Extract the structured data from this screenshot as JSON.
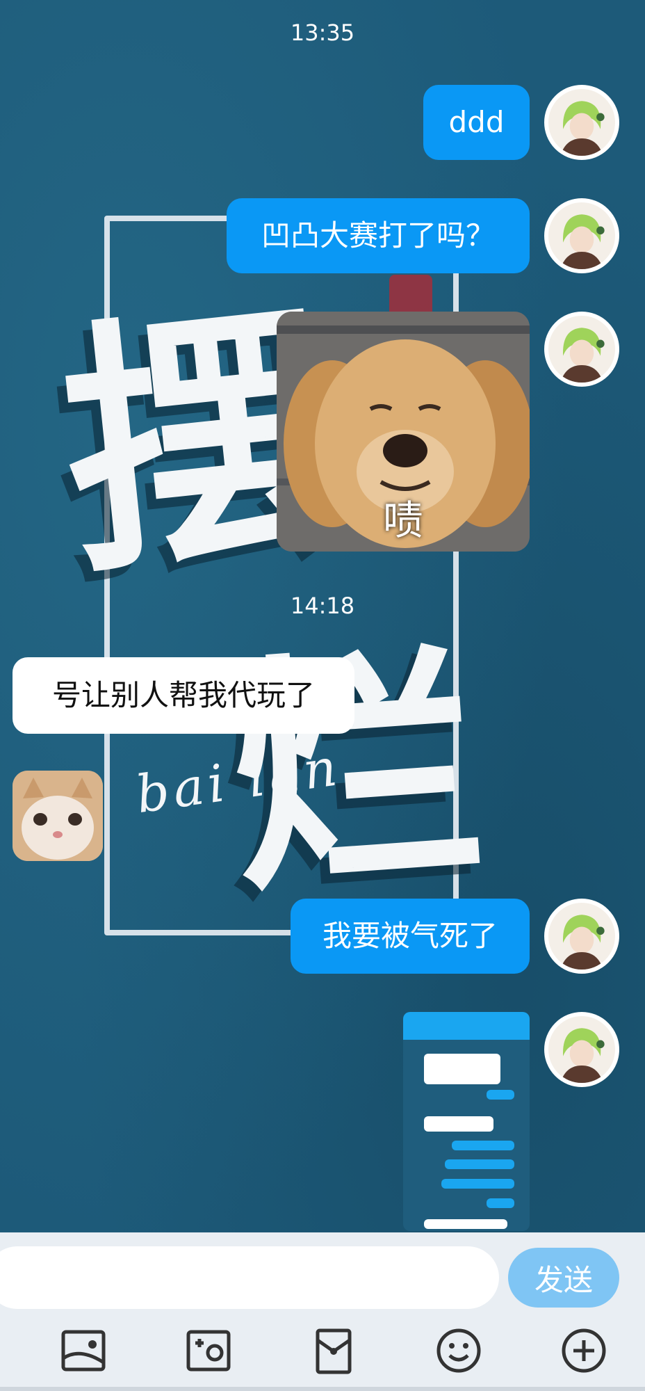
{
  "chat": {
    "timestamps": [
      "13:35",
      "14:18"
    ],
    "messages": {
      "m1": "ddd",
      "m2": "凹凸大赛打了吗？",
      "dog_caption": "啧",
      "m3": "号让别人帮我代玩了",
      "m4": "我要被气死了"
    }
  },
  "wallpaper": {
    "brush_1": "摆",
    "brush_2": "烂",
    "script": "bai lan"
  },
  "input_bar": {
    "placeholder": "",
    "send_label": "发送"
  },
  "toolbar": {
    "icons": [
      "image-icon",
      "camera-icon",
      "red-packet-icon",
      "emoji-icon",
      "plus-icon"
    ]
  },
  "colors": {
    "my_bubble": "#0a98f5",
    "other_bubble": "#ffffff",
    "send_button": "#7fc5f4",
    "background": "#1d5a79"
  }
}
